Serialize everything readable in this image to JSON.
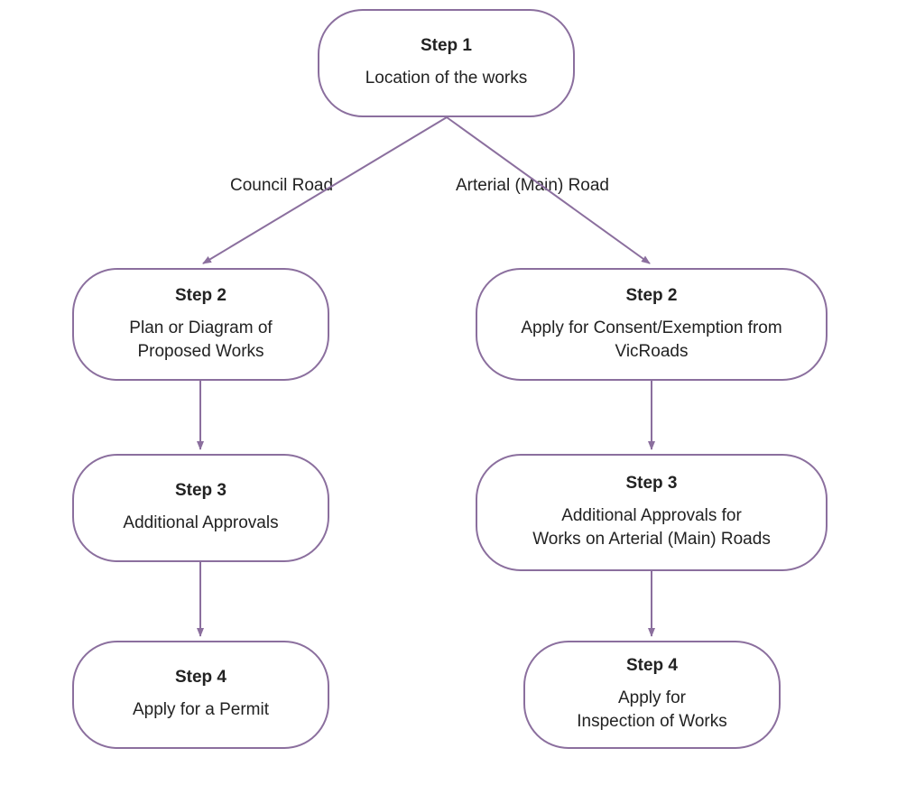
{
  "diagram": {
    "step1": {
      "title": "Step 1",
      "body": "Location of the works"
    },
    "leftBranch": {
      "label": "Council Road",
      "step2": {
        "title": "Step 2",
        "body": "Plan or Diagram of\nProposed Works"
      },
      "step3": {
        "title": "Step 3",
        "body": "Additional Approvals"
      },
      "step4": {
        "title": "Step 4",
        "body": "Apply for a Permit"
      }
    },
    "rightBranch": {
      "label": "Arterial (Main) Road",
      "step2": {
        "title": "Step 2",
        "body": "Apply for Consent/Exemption from\nVicRoads"
      },
      "step3": {
        "title": "Step 3",
        "body": "Additional Approvals for\nWorks on Arterial (Main) Roads"
      },
      "step4": {
        "title": "Step 4",
        "body": "Apply for\nInspection of Works"
      }
    }
  },
  "colors": {
    "border": "#8B6F9E"
  }
}
